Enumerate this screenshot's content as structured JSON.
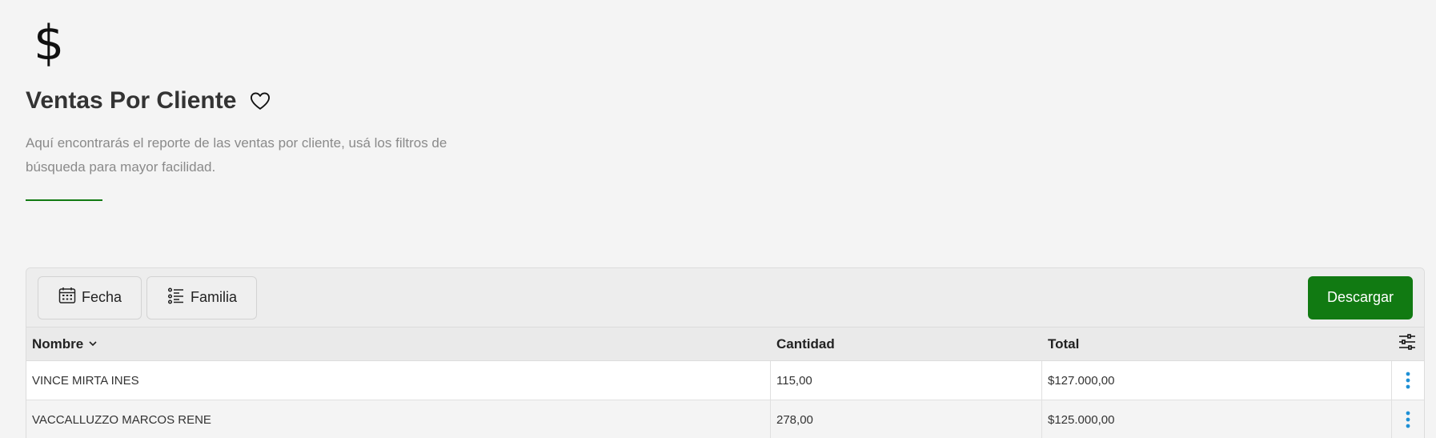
{
  "header": {
    "icon_glyph": "$",
    "icon": "dollar-icon",
    "title": "Ventas Por Cliente",
    "favorite_icon": "heart-outline-icon",
    "description": "Aquí encontrarás el reporte de las ventas por cliente, usá los filtros de búsqueda para mayor facilidad.",
    "accent_color": "#117a12"
  },
  "toolbar": {
    "filters": [
      {
        "label": "Fecha",
        "icon": "calendar-icon"
      },
      {
        "label": "Familia",
        "icon": "list-icon"
      }
    ],
    "download_label": "Descargar",
    "download_color": "#117a12"
  },
  "table": {
    "columns": [
      {
        "label": "Nombre",
        "sort": "chevron-down-icon"
      },
      {
        "label": "Cantidad"
      },
      {
        "label": "Total"
      }
    ],
    "settings_icon": "sliders-icon",
    "row_actions_icon": "more-vertical-icon",
    "row_actions_color": "#1e90d6",
    "rows": [
      {
        "nombre": "VINCE MIRTA INES",
        "cantidad": "115,00",
        "total": "$127.000,00"
      },
      {
        "nombre": "VACCALLUZZO MARCOS RENE",
        "cantidad": "278,00",
        "total": "$125.000,00"
      }
    ]
  }
}
